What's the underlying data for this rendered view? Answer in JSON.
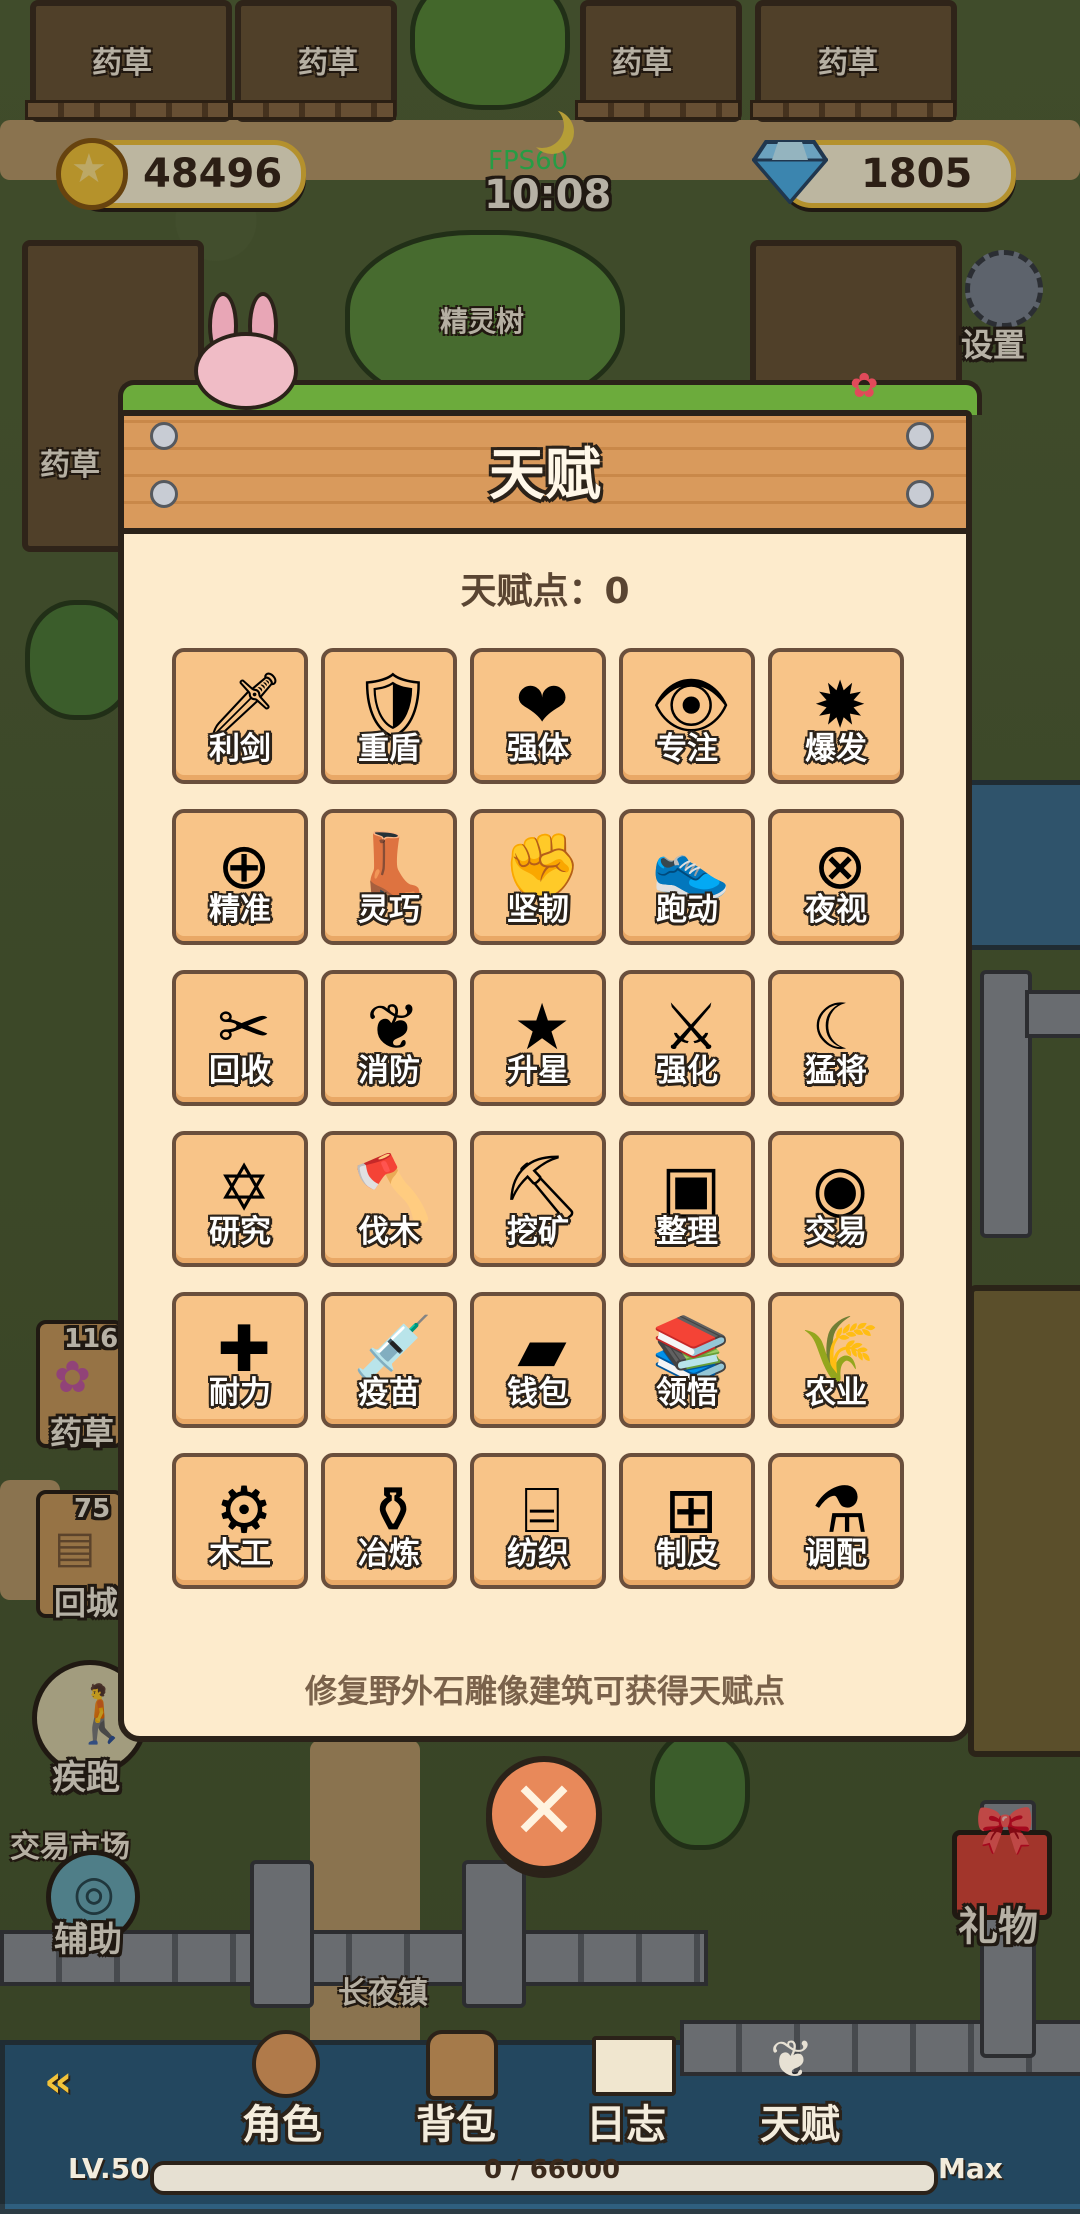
{
  "hud": {
    "coins": "48496",
    "gems": "1805",
    "fps": "FPS60",
    "time": "10:08",
    "settings_label": "设置",
    "colors": {
      "coin_border": "#f1c23c",
      "panel_bg": "#fdebcc",
      "cell_bg": "#f8c488"
    }
  },
  "map": {
    "field_labels": [
      "药草",
      "药草",
      "药草",
      "药草",
      "药草"
    ],
    "tree_label": "精灵树",
    "town_label": "长夜镇",
    "market_label": "交易市场"
  },
  "left_menu": {
    "herb_count": "116",
    "herb_label": "药草",
    "return_count": "75",
    "return_label": "回城",
    "sprint_label": "疾跑",
    "assist_label": "辅助"
  },
  "right_menu": {
    "gift_label": "礼物"
  },
  "modal": {
    "title": "天赋",
    "points_label": "天赋点：0",
    "hint": "修复野外石雕像建筑可获得天赋点",
    "talents": [
      {
        "label": "利剑",
        "icon": "sword-icon",
        "glyph": "🗡"
      },
      {
        "label": "重盾",
        "icon": "shield-icon",
        "glyph": "🛡"
      },
      {
        "label": "强体",
        "icon": "heart-icon",
        "glyph": "❤"
      },
      {
        "label": "专注",
        "icon": "eye-icon",
        "glyph": "👁"
      },
      {
        "label": "爆发",
        "icon": "explosion-icon",
        "glyph": "✹"
      },
      {
        "label": "精准",
        "icon": "crosshair-icon",
        "glyph": "⊕"
      },
      {
        "label": "灵巧",
        "icon": "boots-icon",
        "glyph": "👢"
      },
      {
        "label": "坚韧",
        "icon": "fist-icon",
        "glyph": "✊"
      },
      {
        "label": "跑动",
        "icon": "running-boots-icon",
        "glyph": "👟"
      },
      {
        "label": "夜视",
        "icon": "binoculars-icon",
        "glyph": "⊗"
      },
      {
        "label": "回收",
        "icon": "scissors-icon",
        "glyph": "✂"
      },
      {
        "label": "消防",
        "icon": "leaves-icon",
        "glyph": "❦"
      },
      {
        "label": "升星",
        "icon": "stars-icon",
        "glyph": "★"
      },
      {
        "label": "强化",
        "icon": "sword-shield-icon",
        "glyph": "⚔"
      },
      {
        "label": "猛将",
        "icon": "scimitar-icon",
        "glyph": "☾"
      },
      {
        "label": "研究",
        "icon": "hexagram-icon",
        "glyph": "✡"
      },
      {
        "label": "伐木",
        "icon": "axe-icon",
        "glyph": "🪓"
      },
      {
        "label": "挖矿",
        "icon": "pickaxe-icon",
        "glyph": "⛏"
      },
      {
        "label": "整理",
        "icon": "crate-icon",
        "glyph": "▣"
      },
      {
        "label": "交易",
        "icon": "coins-icon",
        "glyph": "◉"
      },
      {
        "label": "耐力",
        "icon": "first-aid-kit-icon",
        "glyph": "✚"
      },
      {
        "label": "疫苗",
        "icon": "syringe-icon",
        "glyph": "💉"
      },
      {
        "label": "钱包",
        "icon": "wallet-icon",
        "glyph": "▰"
      },
      {
        "label": "领悟",
        "icon": "books-icon",
        "glyph": "📚"
      },
      {
        "label": "农业",
        "icon": "wheat-icon",
        "glyph": "🌾"
      },
      {
        "label": "木工",
        "icon": "saw-icon",
        "glyph": "⚙"
      },
      {
        "label": "冶炼",
        "icon": "furnace-icon",
        "glyph": "⚱"
      },
      {
        "label": "纺织",
        "icon": "loom-icon",
        "glyph": "⌸"
      },
      {
        "label": "制皮",
        "icon": "hide-rack-icon",
        "glyph": "⊞"
      },
      {
        "label": "调配",
        "icon": "potion-icon",
        "glyph": "⚗"
      }
    ]
  },
  "bottom_nav": {
    "items": [
      {
        "label": "角色",
        "icon": "character-icon"
      },
      {
        "label": "背包",
        "icon": "backpack-icon"
      },
      {
        "label": "日志",
        "icon": "journal-icon"
      },
      {
        "label": "天赋",
        "icon": "talent-wings-icon"
      }
    ],
    "level": "LV.50",
    "xp": "0 / 66000",
    "xp_fraction": 0,
    "max_label": "Max"
  }
}
